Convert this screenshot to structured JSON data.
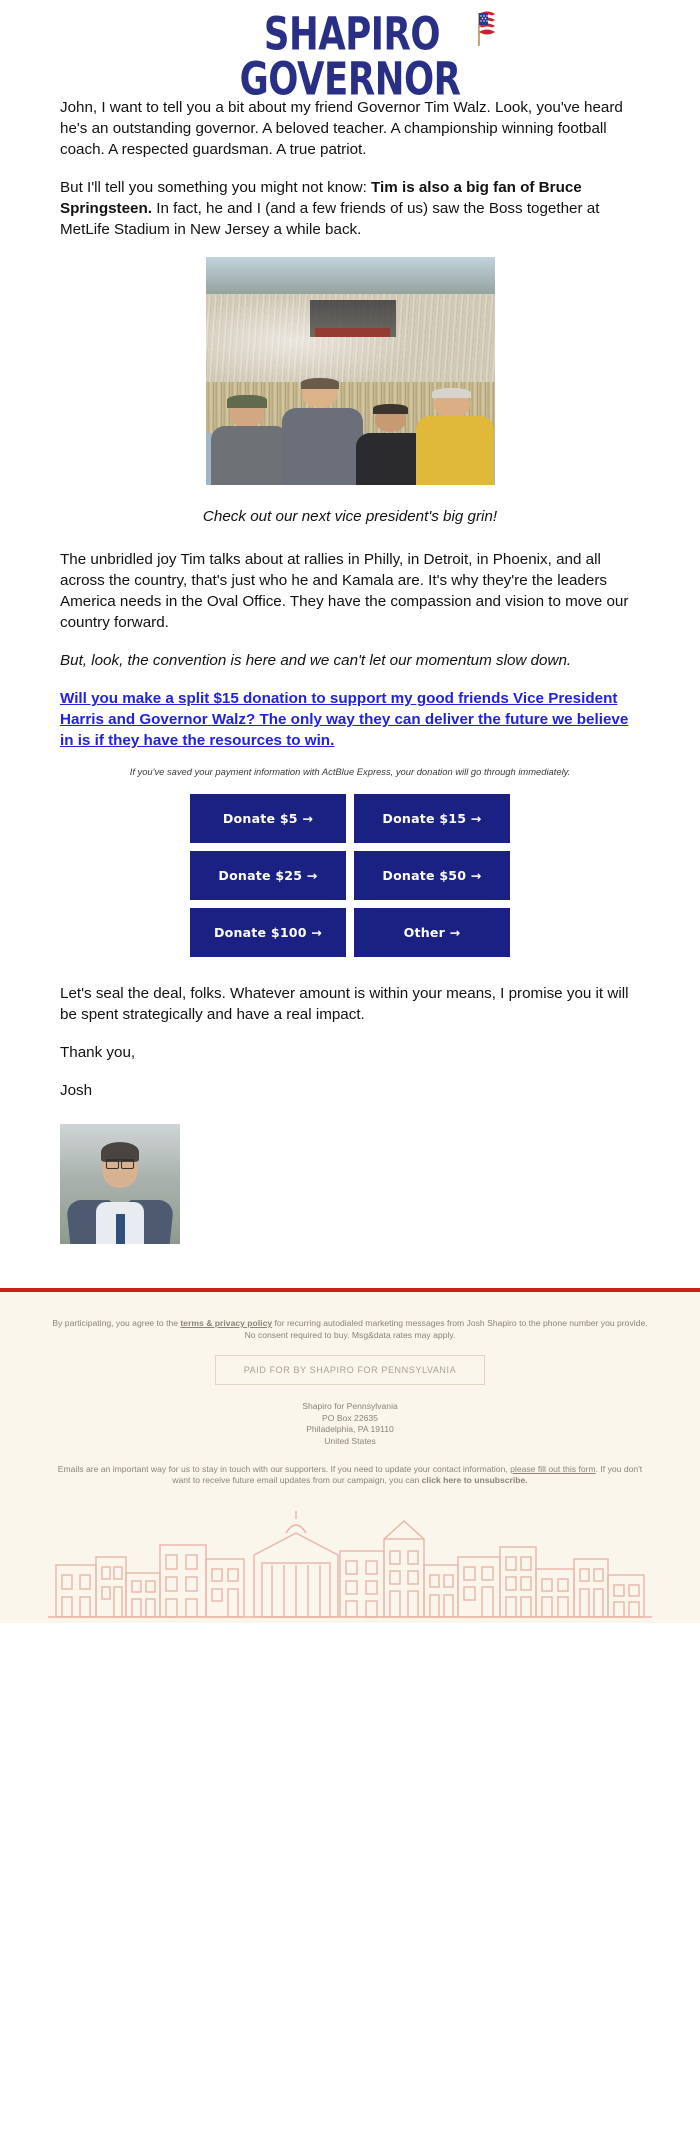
{
  "logo": {
    "line1": "SHAPIRO",
    "line2": "GOVERNOR",
    "flag_icon": "us-flag-icon",
    "color": "#2a2f86"
  },
  "body": {
    "para1": "John, I want to tell you a bit about my friend Governor Tim Walz. Look, you've heard he's an outstanding governor. A beloved teacher. A championship winning football coach. A respected guardsman. A true patriot.",
    "para2_pre": "But I'll tell you something you might not know: ",
    "para2_bold": "Tim is also a big fan of Bruce Springsteen.",
    "para2_post": " In fact, he and I (and a few friends of us) saw the Boss together at MetLife Stadium in New Jersey a while back.",
    "photo_caption": "Check out our next vice president's big grin!",
    "para3": "The unbridled joy Tim talks about at rallies in Philly, in Detroit, in Phoenix, and all across the country, that's just who he and Kamala are. It's why they're the leaders America needs in the Oval Office. They have the compassion and vision to move our country forward.",
    "para4_italic": "But, look, the convention is here and we can't let our momentum slow down.",
    "donate_link": "Will you make a split $15 donation to support my good friends Vice President Harris and Governor Walz? The only way they can deliver the future we believe in is if they have the resources to win.",
    "actblue_note": "If you've saved your payment information with ActBlue Express, your donation will go through immediately.",
    "para5": "Let's seal the deal, folks. Whatever amount is within your means, I promise you it will be spent strategically and have a real impact.",
    "thank_you": "Thank you,",
    "signature": "Josh"
  },
  "donate_buttons": [
    {
      "label": "Donate $5 →"
    },
    {
      "label": "Donate $15 →"
    },
    {
      "label": "Donate $25 →"
    },
    {
      "label": "Donate $50 →"
    },
    {
      "label": "Donate $100 →"
    },
    {
      "label": "Other →"
    }
  ],
  "colors": {
    "link": "#2121e0",
    "button_bg": "#1b2183",
    "footer_bg": "#faf6eb",
    "footer_rule": "#cc1f1a"
  },
  "footer": {
    "sms_pre": "By participating, you agree to the ",
    "sms_link": "terms & privacy policy",
    "sms_post": " for recurring autodialed marketing messages from Josh Shapiro to the phone number you provide. No consent required to buy. Msg&data rates may apply.",
    "paid_for": "PAID FOR BY SHAPIRO FOR PENNSYLVANIA",
    "address_line1": "Shapiro for Pennsylvania",
    "address_line2": "PO Box 22635",
    "address_line3": "Philadelphia, PA 19110",
    "address_line4": "United States",
    "note_pre": "Emails are an important way for us to stay in touch with our supporters. If you need to update your contact information, ",
    "note_link1": "please fill out this form",
    "note_mid": ". If you don't want to receive future email updates from our campaign, you can ",
    "note_link2": "click here to unsubscribe.",
    "skyline_icon": "city-skyline-illustration"
  }
}
